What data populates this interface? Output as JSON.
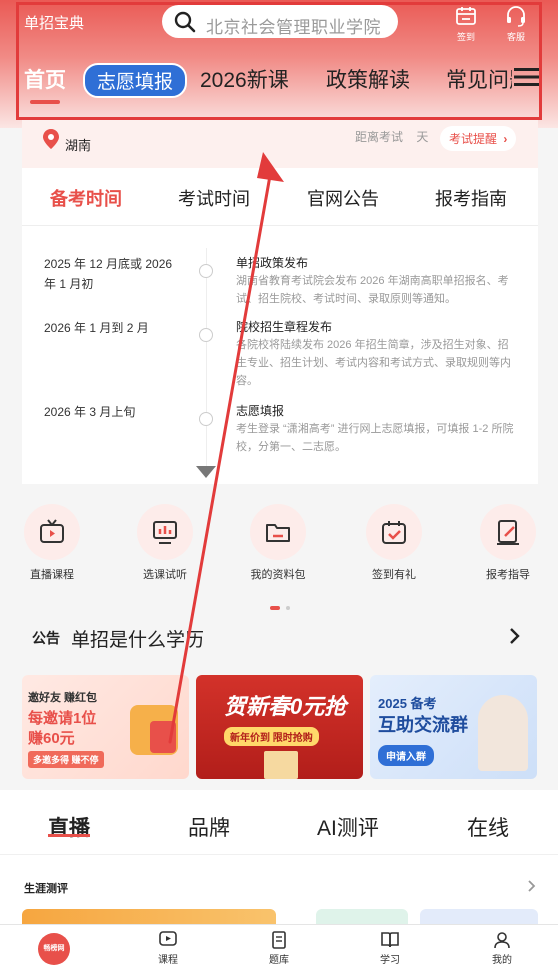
{
  "header": {
    "app_name": "单招宝典",
    "search_placeholder": "北京社会管理职业学院",
    "checkin_label": "签到",
    "service_label": "客服"
  },
  "nav": {
    "tabs": [
      "首页",
      "志愿填报",
      "2026新课",
      "政策解读",
      "常见问题"
    ]
  },
  "location": {
    "province": "湖南",
    "countdown_prefix": "距离考试",
    "countdown_suffix": "天",
    "reminder_button": "考试提醒"
  },
  "info_tabs": [
    "备考时间",
    "考试时间",
    "官网公告",
    "报考指南"
  ],
  "timeline": [
    {
      "date": "2025 年 12 月底或 2026 年 1 月初",
      "title": "单招政策发布",
      "desc": "湖南省教育考试院会发布 2026 年湖南高职单招报名、考试、招生院校、考试时间、录取原则等通知。"
    },
    {
      "date": "2026 年 1 月到 2 月",
      "title": "院校招生章程发布",
      "desc": "各院校将陆续发布 2026 年招生简章，涉及招生对象、招生专业、招生计划、考试内容和考试方式、录取规则等内容。"
    },
    {
      "date": "2026 年 3 月上旬",
      "title": "志愿填报",
      "desc": "考生登录 “潇湘高考” 进行网上志愿填报，可填报 1-2 所院校，分第一、二志愿。"
    }
  ],
  "quick_links": [
    {
      "label": "直播课程",
      "icon": "tv-icon"
    },
    {
      "label": "选课试听",
      "icon": "chart-board-icon"
    },
    {
      "label": "我的资料包",
      "icon": "folder-icon"
    },
    {
      "label": "签到有礼",
      "icon": "calendar-check-icon"
    },
    {
      "label": "报考指导",
      "icon": "edit-doc-icon"
    }
  ],
  "notice": {
    "tag": "公告",
    "text": "单招是什么学历"
  },
  "banners": [
    {
      "line1": "邀好友 赚红包",
      "line2": "每邀请1位",
      "line3": "赚60元",
      "line4": "多邀多得 赚不停"
    },
    {
      "line1": "贺新春0元抢",
      "line2": "新年价到 限时抢购"
    },
    {
      "line1": "2025 备考",
      "line2": "互助交流群",
      "line3": "申请入群"
    }
  ],
  "section_tabs": [
    "直播",
    "品牌",
    "AI测评",
    "在线"
  ],
  "career": {
    "title": "生涯测评"
  },
  "bottom_nav": {
    "home_logo": "畅榜网",
    "items": [
      "课程",
      "题库",
      "学习",
      "我的"
    ]
  },
  "colors": {
    "accent": "#e8504a",
    "pill": "#2f6fd6",
    "annotation": "#e23b3b"
  }
}
